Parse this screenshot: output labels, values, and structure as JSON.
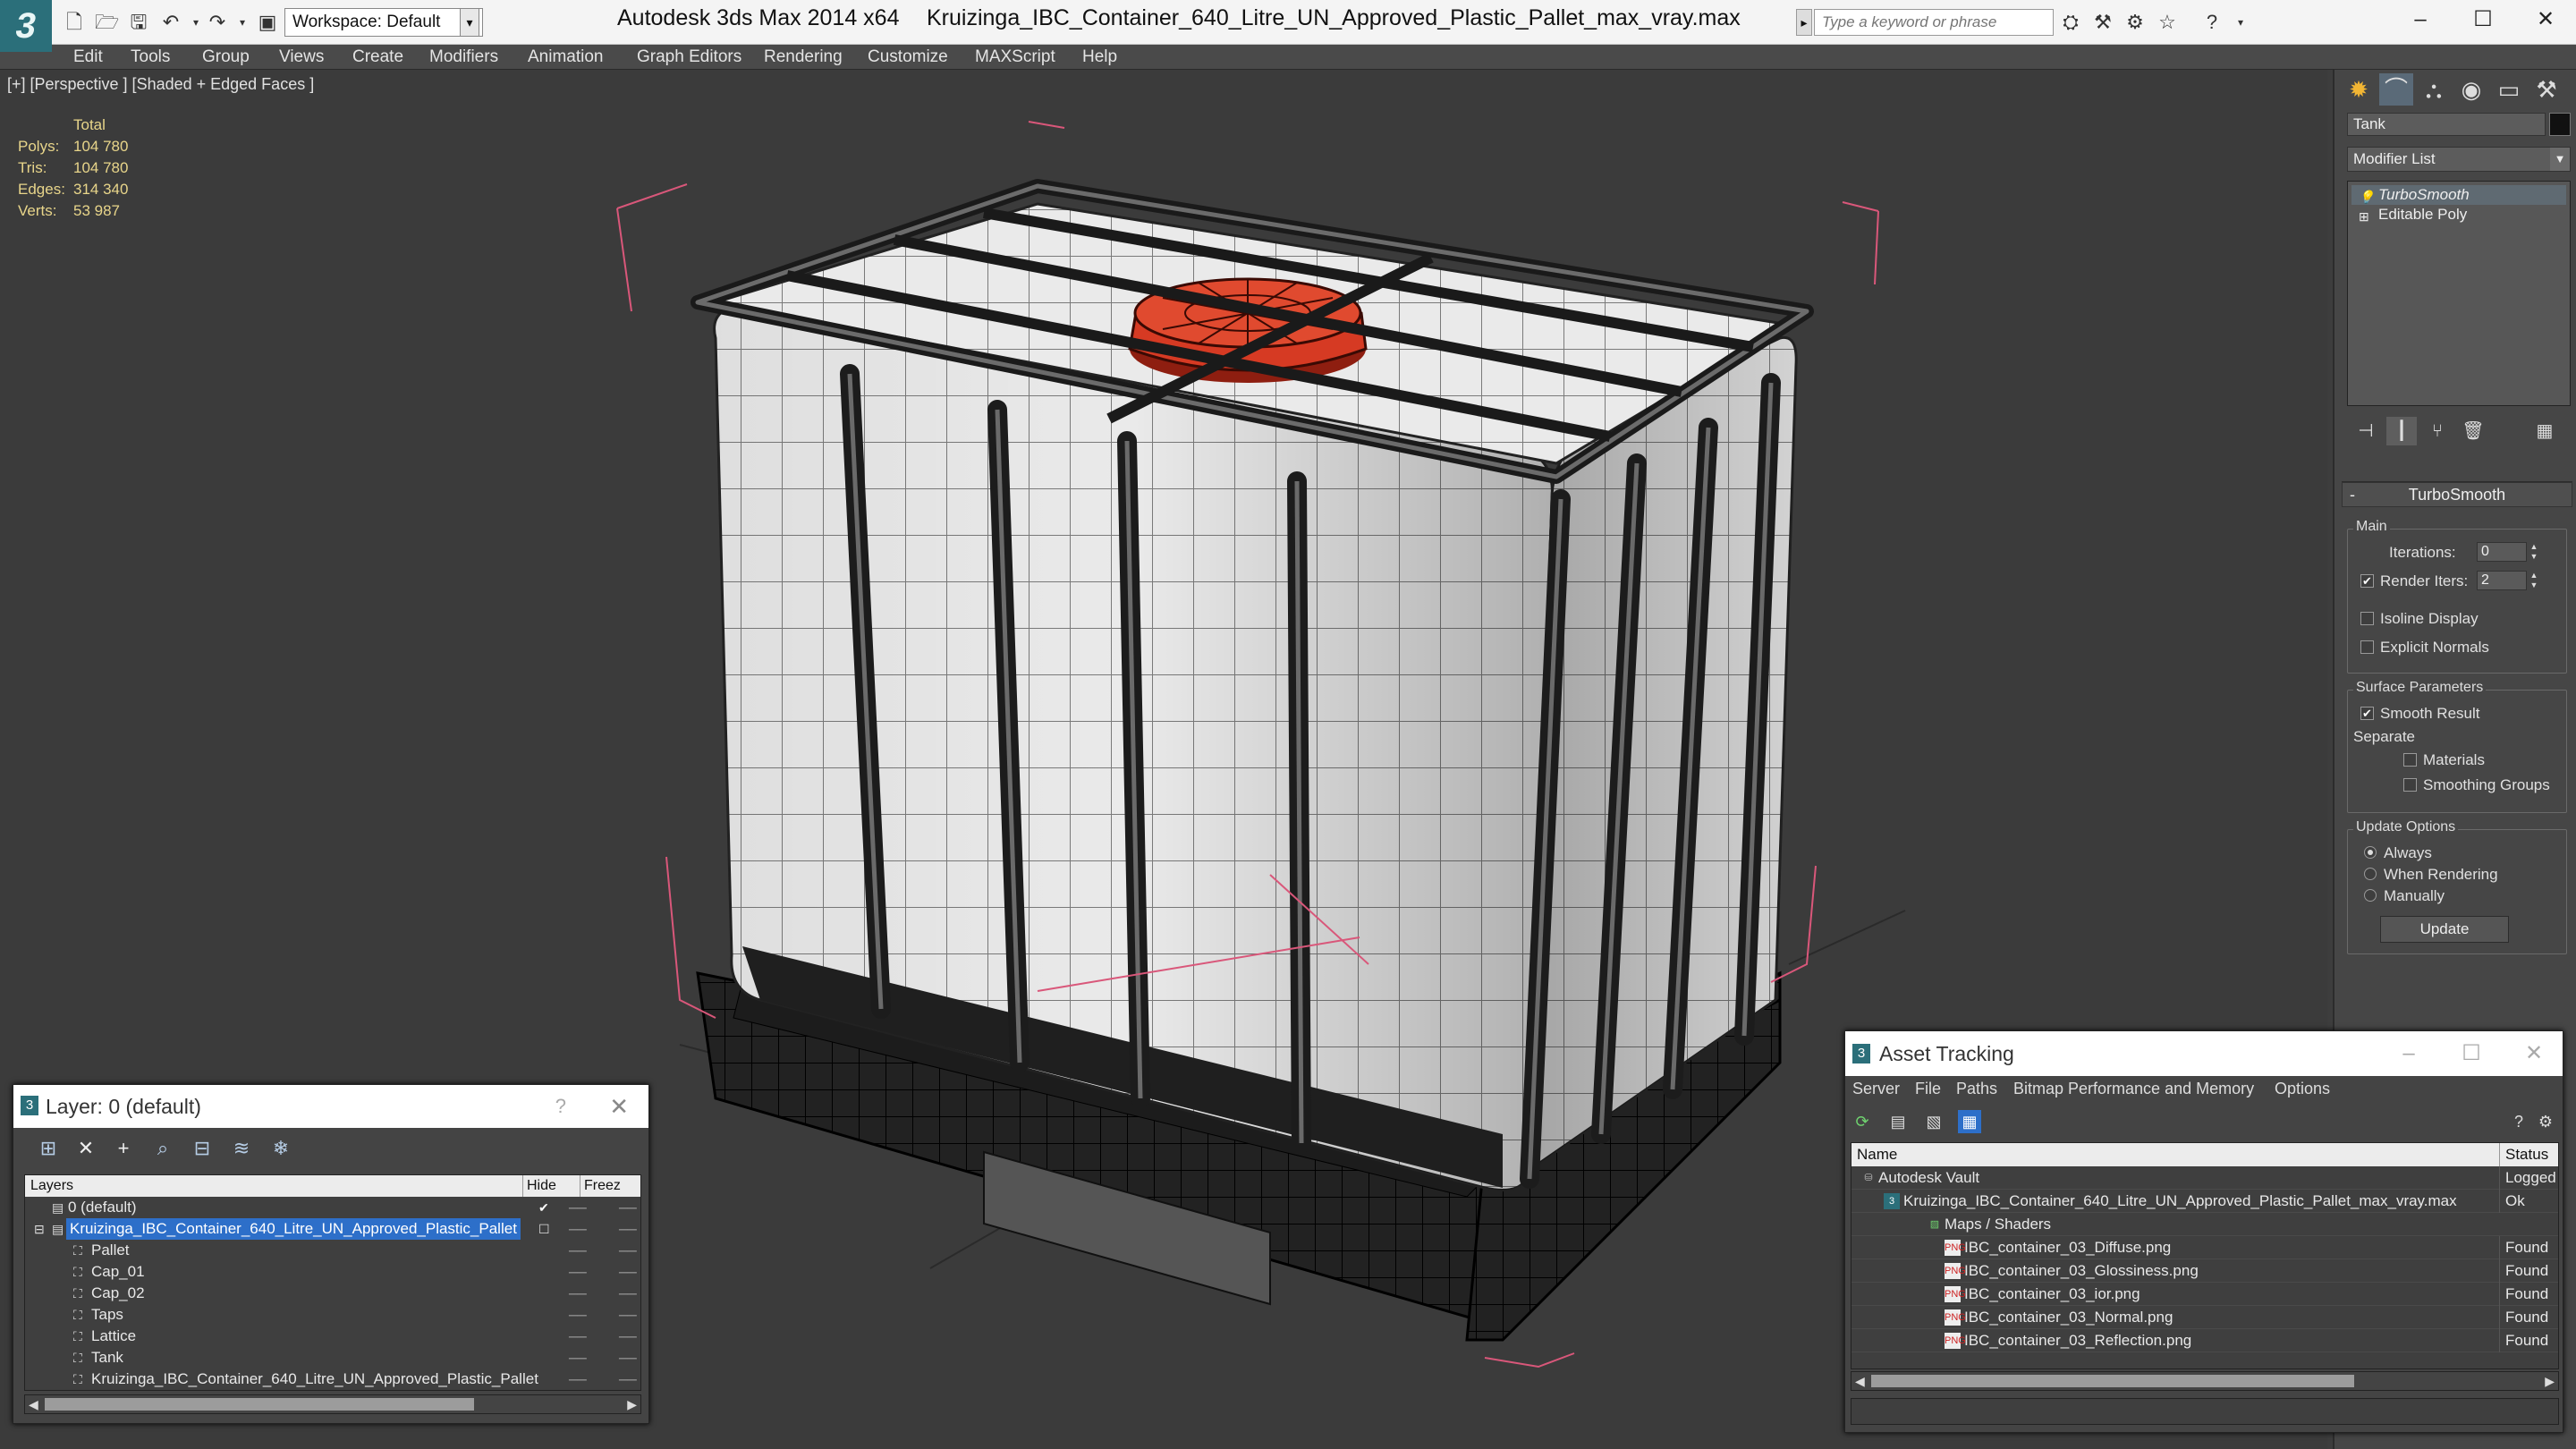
{
  "titlebar": {
    "workspace": "Workspace: Default",
    "app_title": "Autodesk 3ds Max  2014 x64",
    "file_title": "Kruizinga_IBC_Container_640_Litre_UN_Approved_Plastic_Pallet_max_vray.max",
    "search_placeholder": "Type a keyword or phrase",
    "logo_letter": "3"
  },
  "menu": [
    "Edit",
    "Tools",
    "Group",
    "Views",
    "Create",
    "Modifiers",
    "Animation",
    "Graph Editors",
    "Rendering",
    "Customize",
    "MAXScript",
    "Help"
  ],
  "viewport": {
    "label": "[+] [Perspective ] [Shaded + Edged Faces ]",
    "stats": {
      "header": "Total",
      "rows": [
        {
          "k": "Polys:",
          "v": "104 780"
        },
        {
          "k": "Tris:",
          "v": "104 780"
        },
        {
          "k": "Edges:",
          "v": "314 340"
        },
        {
          "k": "Verts:",
          "v": "53 987"
        }
      ]
    }
  },
  "command_panel": {
    "object_name": "Tank",
    "modifier_list": "Modifier List",
    "stack": [
      "TurboSmooth",
      "Editable Poly"
    ],
    "rollout_title": "TurboSmooth",
    "main_group": "Main",
    "iterations_label": "Iterations:",
    "iterations_value": "0",
    "render_iters_label": "Render Iters:",
    "render_iters_value": "2",
    "render_iters_checked": true,
    "isoline_label": "Isoline Display",
    "explicit_normals_label": "Explicit Normals",
    "surface_group": "Surface Parameters",
    "smooth_result_label": "Smooth Result",
    "separate_label": "Separate",
    "materials_label": "Materials",
    "smoothing_groups_label": "Smoothing Groups",
    "update_group": "Update Options",
    "always_label": "Always",
    "when_rendering_label": "When Rendering",
    "manually_label": "Manually",
    "update_button": "Update"
  },
  "layer_dialog": {
    "title": "Layer: 0 (default)",
    "help": "?",
    "col_layers": "Layers",
    "col_hide": "Hide",
    "col_freeze": "Freez",
    "rows": [
      {
        "name": "0 (default)",
        "indent": 0,
        "selected": false
      },
      {
        "name": "Kruizinga_IBC_Container_640_Litre_UN_Approved_Plastic_Pallet",
        "indent": 0,
        "selected": true
      },
      {
        "name": "Pallet",
        "indent": 1,
        "selected": false
      },
      {
        "name": "Cap_01",
        "indent": 1,
        "selected": false
      },
      {
        "name": "Cap_02",
        "indent": 1,
        "selected": false
      },
      {
        "name": "Taps",
        "indent": 1,
        "selected": false
      },
      {
        "name": "Lattice",
        "indent": 1,
        "selected": false
      },
      {
        "name": "Tank",
        "indent": 1,
        "selected": false
      },
      {
        "name": "Kruizinga_IBC_Container_640_Litre_UN_Approved_Plastic_Pallet",
        "indent": 1,
        "selected": false
      }
    ]
  },
  "asset_dialog": {
    "title": "Asset Tracking",
    "menu": [
      "Server",
      "File",
      "Paths",
      "Bitmap Performance and Memory",
      "Options"
    ],
    "col_name": "Name",
    "col_status": "Status",
    "rows": [
      {
        "name": "Autodesk Vault",
        "indent": 0,
        "status": "Logged",
        "icon": "vault-icon"
      },
      {
        "name": "Kruizinga_IBC_Container_640_Litre_UN_Approved_Plastic_Pallet_max_vray.max",
        "indent": 1,
        "status": "Ok",
        "icon": "max-file-icon"
      },
      {
        "name": "Maps / Shaders",
        "indent": 2,
        "status": "",
        "icon": "maps-icon"
      },
      {
        "name": "IBC_container_03_Diffuse.png",
        "indent": 3,
        "status": "Found",
        "icon": "png-icon"
      },
      {
        "name": "IBC_container_03_Glossiness.png",
        "indent": 3,
        "status": "Found",
        "icon": "png-icon"
      },
      {
        "name": "IBC_container_03_ior.png",
        "indent": 3,
        "status": "Found",
        "icon": "png-icon"
      },
      {
        "name": "IBC_container_03_Normal.png",
        "indent": 3,
        "status": "Found",
        "icon": "png-icon"
      },
      {
        "name": "IBC_container_03_Reflection.png",
        "indent": 3,
        "status": "Found",
        "icon": "png-icon"
      }
    ]
  },
  "colors": {
    "accent": "#2d6fc9",
    "cap": "#d63a23",
    "stats": "#e8d58a",
    "selection_box": "#d9577a"
  }
}
